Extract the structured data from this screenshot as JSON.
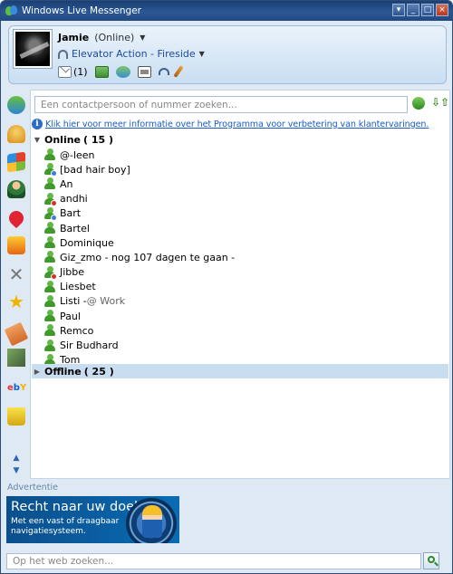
{
  "window": {
    "title": "Windows Live Messenger"
  },
  "profile": {
    "name": "Jamie",
    "status": "(Online)",
    "personal_message": "Elevator Action - Fireside",
    "mail_count": "(1)"
  },
  "search": {
    "placeholder": "Een contactpersoon of nummer zoeken..."
  },
  "info_banner": {
    "text": "Klik hier voor meer informatie over het Programma voor verbetering van klantervaringen."
  },
  "groups": {
    "online": {
      "name": "Online",
      "count": "( 15 )"
    },
    "offline": {
      "name": "Offline",
      "count": "( 25 )"
    }
  },
  "contacts": [
    {
      "name": "@-leen",
      "pm": "",
      "status": "online"
    },
    {
      "name": "[bad hair boy]",
      "pm": "",
      "status": "away"
    },
    {
      "name": "An",
      "pm": "",
      "status": "online"
    },
    {
      "name": "andhi",
      "pm": "",
      "status": "busy"
    },
    {
      "name": "Bart",
      "pm": "",
      "status": "away"
    },
    {
      "name": "Bartel",
      "pm": "",
      "status": "online"
    },
    {
      "name": "Dominique",
      "pm": "",
      "status": "online"
    },
    {
      "name": "Giz_zmo - nog 107 dagen te gaan -",
      "pm": "",
      "status": "online"
    },
    {
      "name": "Jibbe",
      "pm": "",
      "status": "busy"
    },
    {
      "name": "Liesbet",
      "pm": "",
      "status": "online"
    },
    {
      "name": "Listi - ",
      "pm": "@ Work",
      "status": "online"
    },
    {
      "name": "Paul",
      "pm": "",
      "status": "online"
    },
    {
      "name": "Remco",
      "pm": "",
      "status": "online"
    },
    {
      "name": "Sir Budhard",
      "pm": "",
      "status": "online"
    },
    {
      "name": "Tom",
      "pm": "",
      "status": "online"
    }
  ],
  "ad": {
    "label": "Advertentie",
    "headline": "Recht naar uw doel.",
    "subline": "Met een vast of draagbaar navigatiesysteem."
  },
  "web_search": {
    "placeholder": "Op het web zoeken..."
  },
  "colors": {
    "title_bar": "#2a5794",
    "link": "#1b5bc4",
    "offline_group_bg": "#c9ddf0",
    "online_green": "#3f9a2b"
  }
}
